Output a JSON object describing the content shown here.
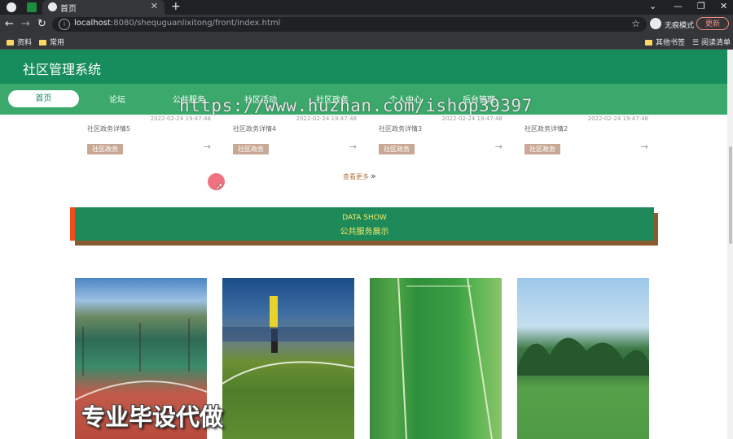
{
  "browser": {
    "tab_title": "首页",
    "url_host": "localhost",
    "url_path": ":8080/shequguanlixitong/front/index.html",
    "incognito_label": "无痕模式",
    "update_label": "更新",
    "bookmarks": [
      "资料",
      "常用"
    ],
    "bookmarks_right": [
      "其他书签",
      "阅读清单"
    ]
  },
  "site": {
    "title": "社区管理系统",
    "menu": [
      "首页",
      "论坛",
      "公共服务",
      "社区活动",
      "社区政务",
      "个人中心",
      "后台管理"
    ],
    "active_menu": "首页"
  },
  "watermark_url": "https://www.huzhan.com/ishop39397",
  "news_cards": [
    {
      "date": "2022-02-24 19:47:48",
      "title": "社区政务详情5",
      "tag": "社区政务"
    },
    {
      "date": "2022-02-24 19:47:48",
      "title": "社区政务详情4",
      "tag": "社区政务"
    },
    {
      "date": "2022-02-24 19:47:48",
      "title": "社区政务详情3",
      "tag": "社区政务"
    },
    {
      "date": "2022-02-24 19:47:48",
      "title": "社区政务详情2",
      "tag": "社区政务"
    }
  ],
  "more_label": "查看更多",
  "section": {
    "en": "DATA SHOW",
    "cn": "公共服务展示"
  },
  "photos": [
    "basketball court",
    "football pitch",
    "artificial turf field",
    "grass field"
  ],
  "bottom_watermark": "专业毕设代做",
  "colors": {
    "header": "#178c5c",
    "menu": "#3aa96b",
    "section": "#1e8a5a",
    "accent": "#f04d1a",
    "tag": "#c9a995"
  }
}
